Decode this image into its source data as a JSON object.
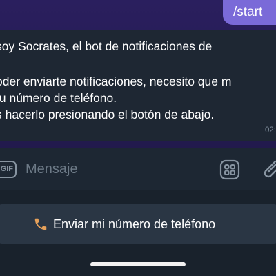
{
  "chat": {
    "outgoing": {
      "text": "/start"
    },
    "incoming": {
      "lines": [
        "soy Socrates, el bot de notificaciones de",
        "",
        "oder enviarte notificaciones, necesito que m",
        " tu número de teléfono.",
        "s hacerlo presionando el botón de abajo."
      ],
      "time": "02:"
    }
  },
  "input_bar": {
    "gif_label": "GIF",
    "placeholder": "Mensaje",
    "icons": {
      "left": "gif-icon",
      "bot_commands": "bot-commands-icon",
      "attach": "paperclip-icon"
    }
  },
  "keyboard": {
    "button_icon": "phone-icon",
    "button_label": "Enviar mi número de teléfono"
  },
  "colors": {
    "chat_background": "#241b50",
    "outgoing_bubble": "#7a6ad8",
    "incoming_bubble": "#1e2733",
    "input_bar": "#1d2733",
    "keyboard_background": "#19222c",
    "keyboard_button": "#2a3644",
    "muted_text": "#6d7a87"
  }
}
